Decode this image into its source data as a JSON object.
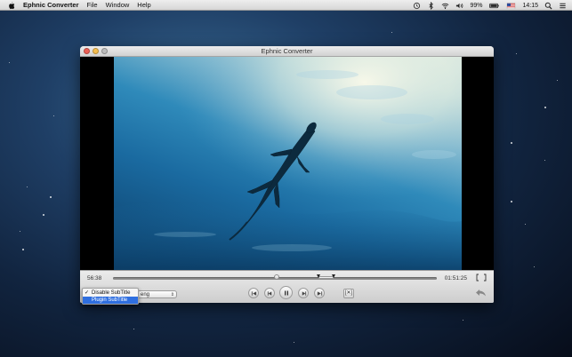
{
  "menubar": {
    "app_name": "Ephnic Converter",
    "menus": [
      "File",
      "Window",
      "Help"
    ],
    "battery_percent": "99%",
    "clock": "14:15",
    "status_icons": [
      "time-machine-icon",
      "bluetooth-icon",
      "wifi-icon",
      "volume-icon",
      "battery-icon",
      "flag-icon",
      "search-icon",
      "list-icon"
    ]
  },
  "window": {
    "title": "Ephnic Converter"
  },
  "player": {
    "current_time": "56:38",
    "total_time": "01:51:25",
    "progress": 0.5,
    "subtitle_language": "eng",
    "subtitle_menu": {
      "items": [
        "Disable SubTitle",
        "Plugin SubTitle"
      ],
      "checked_index": 0,
      "highlighted_index": 1,
      "check_mark": "✓"
    },
    "crop_label": "[✕]"
  },
  "colors": {
    "accent": "#2f6fe0",
    "water_deep": "#12507f",
    "water_light": "#cfe2dc"
  }
}
